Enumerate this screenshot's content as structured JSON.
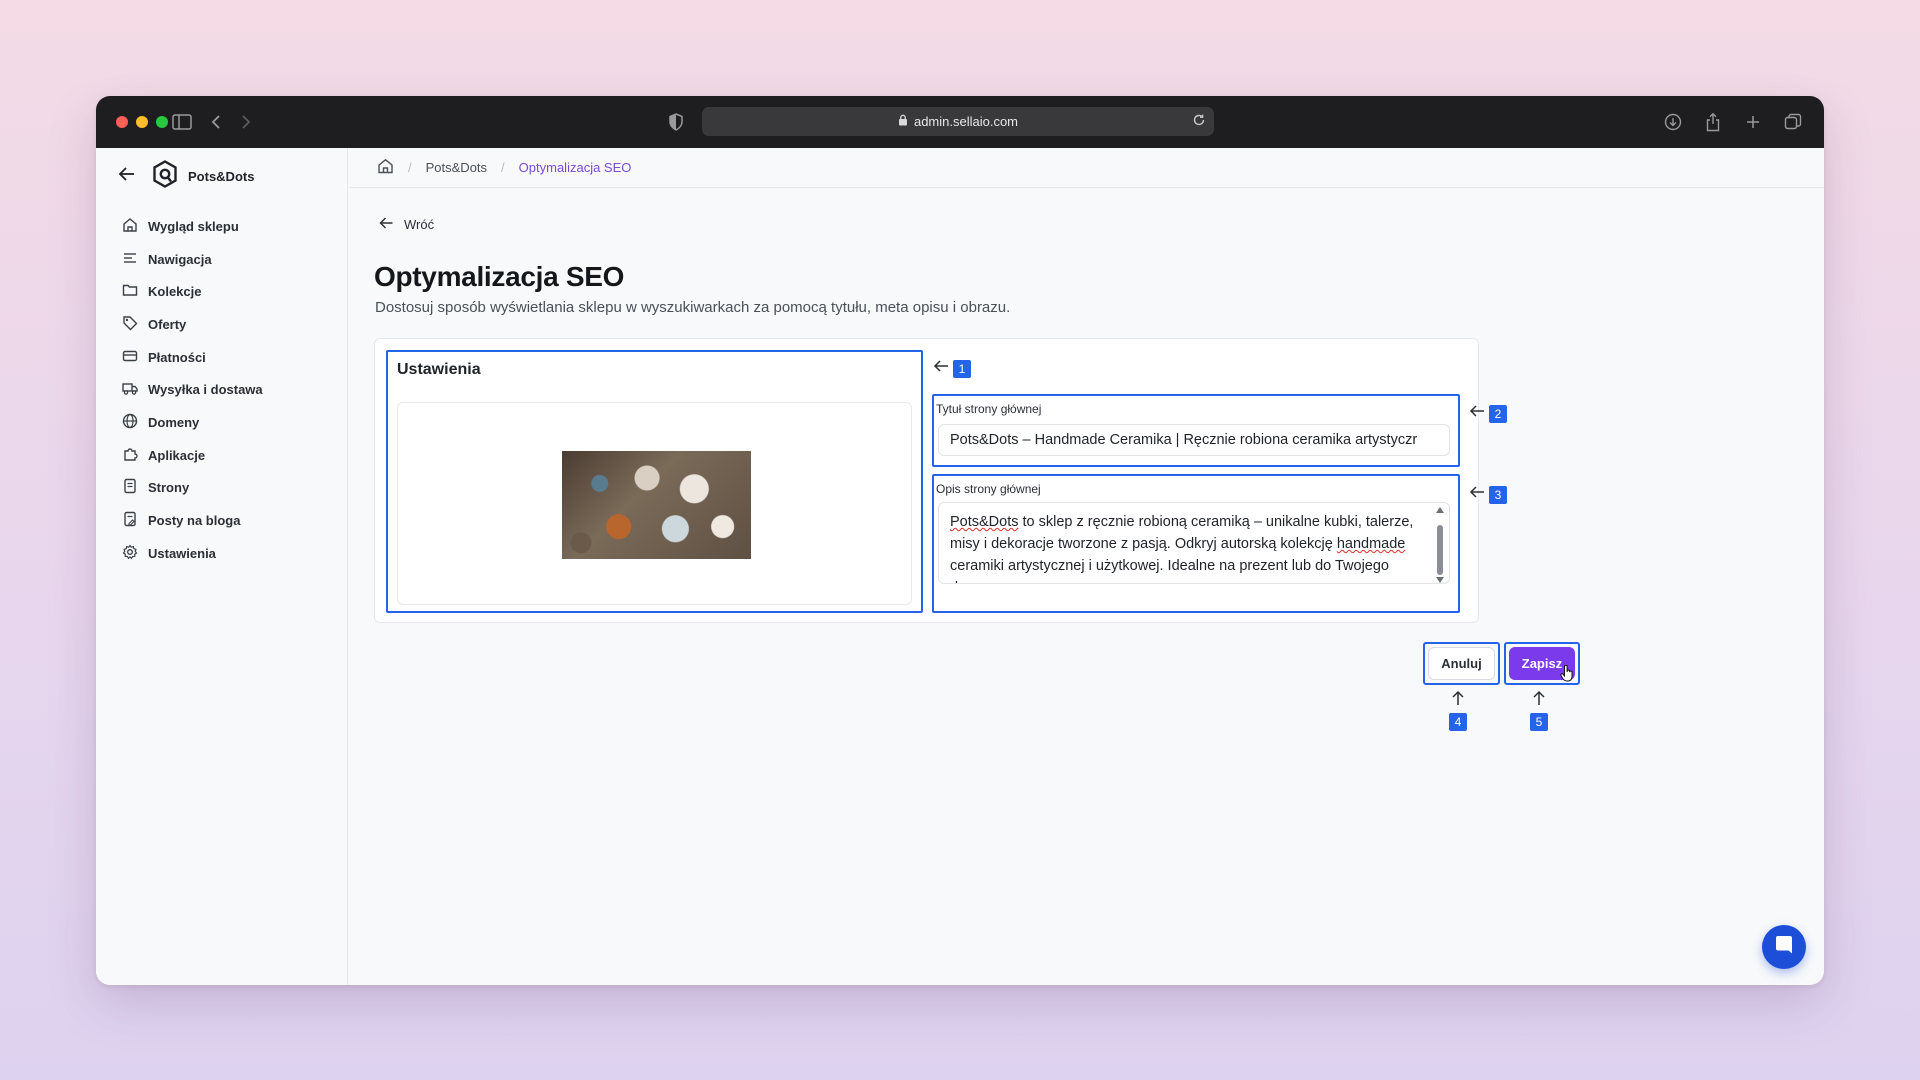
{
  "browser": {
    "url": "admin.sellaio.com"
  },
  "sidebar": {
    "brand": "Pots&Dots",
    "items": [
      {
        "label": "Wygląd sklepu",
        "icon": "home-icon"
      },
      {
        "label": "Nawigacja",
        "icon": "menu-lines-icon"
      },
      {
        "label": "Kolekcje",
        "icon": "folder-icon"
      },
      {
        "label": "Oferty",
        "icon": "tag-icon"
      },
      {
        "label": "Płatności",
        "icon": "credit-card-icon"
      },
      {
        "label": "Wysyłka i dostawa",
        "icon": "truck-icon"
      },
      {
        "label": "Domeny",
        "icon": "globe-icon"
      },
      {
        "label": "Aplikacje",
        "icon": "puzzle-icon"
      },
      {
        "label": "Strony",
        "icon": "page-icon"
      },
      {
        "label": "Posty na bloga",
        "icon": "blog-post-icon"
      },
      {
        "label": "Ustawienia",
        "icon": "gear-icon"
      }
    ]
  },
  "breadcrumb": {
    "items": [
      "Pots&Dots",
      "Optymalizacja SEO"
    ]
  },
  "main": {
    "back_label": "Wróć",
    "title": "Optymalizacja SEO",
    "subtitle": "Dostosuj sposób wyświetlania sklepu w wyszukiwarkach za pomocą tytułu, meta opisu i obrazu.",
    "settings_title": "Ustawienia",
    "title_field": {
      "label": "Tytuł strony głównej",
      "value": "Pots&Dots – Handmade Ceramika | Ręcznie robiona ceramika artystyczr"
    },
    "description_field": {
      "label": "Opis strony głównej",
      "value_word1": "Pots&Dots",
      "value_part1": " to sklep z ręcznie robioną ceramiką – unikalne kubki, talerze, misy i dekoracje tworzone z pasją. Odkryj autorską kolekcję ",
      "value_word2": "handmade",
      "value_part2": " ceramiki artystycznej i użytkowej. Idealne na prezent lub do Twojego domu."
    },
    "cancel_label": "Anuluj",
    "save_label": "Zapisz"
  },
  "annotations": [
    "1",
    "2",
    "3",
    "4",
    "5"
  ],
  "colors": {
    "accent": "#7c3aed",
    "annotation": "#2563eb",
    "breadcrumb_current": "#7a4bd1"
  }
}
